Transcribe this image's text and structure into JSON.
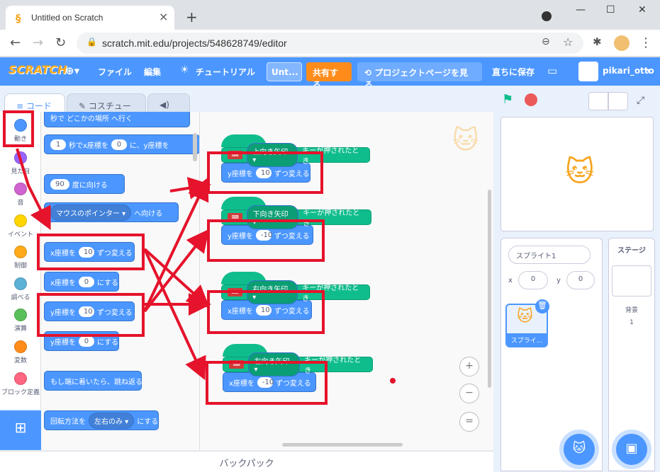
{
  "browser": {
    "tab_title": "Untitled on Scratch",
    "url": "scratch.mit.edu/projects/548628749/editor",
    "new_tab": "+",
    "win_minimize": "—",
    "win_maximize": "☐",
    "win_close": "✕"
  },
  "menubar": {
    "logo": "SCRATCH",
    "file": "ファイル",
    "edit": "編集",
    "tutorial": "チュートリアル",
    "project_title": "Unt...",
    "share": "共有する",
    "project_page": "プロジェクトページを見る",
    "save_now": "直ちに保存",
    "username": "pikari_otto"
  },
  "tabs": {
    "code": "コード",
    "costume": "コスチューム",
    "sound": "音"
  },
  "categories": [
    {
      "label": "動き",
      "color": "#4c97ff"
    },
    {
      "label": "見た目",
      "color": "#9966ff"
    },
    {
      "label": "音",
      "color": "#cf63cf"
    },
    {
      "label": "イベント",
      "color": "#ffd500"
    },
    {
      "label": "制御",
      "color": "#ffab19"
    },
    {
      "label": "調べる",
      "color": "#5cb1d6"
    },
    {
      "label": "演算",
      "color": "#59c059"
    },
    {
      "label": "変数",
      "color": "#ff8c1a"
    },
    {
      "label": "ブロック定義",
      "color": "#ff6680"
    }
  ],
  "palette": {
    "goto_top": "秒で どこかの場所 へ行く",
    "glide_secs": "1",
    "glide_text1": "秒でx座標を",
    "glide_x": "0",
    "glide_text2": "に、y座標を",
    "point_dir": "90",
    "point_text": "度に向ける",
    "towards_dd": "マウスのポインター ▾",
    "towards_text": "へ向ける",
    "change_x_text": "x座標を",
    "change_x_val": "10",
    "change_suffix": "ずつ変える",
    "set_x_text": "x座標を",
    "set_x_val": "0",
    "set_suffix": "にする",
    "change_y_text": "y座標を",
    "change_y_val": "10",
    "set_y_text": "y座標を",
    "set_y_val": "0",
    "bounce": "もし端に着いたら、跳ね返る",
    "rotation_text": "回転方法を",
    "rotation_dd": "左右のみ ▾",
    "rotation_suffix": "にする"
  },
  "scripts": [
    {
      "key_label": "上向き矢印 ▾",
      "event_suffix": "キーが押されたとき",
      "axis": "y座標を",
      "value": "10",
      "suffix": "ずつ変える"
    },
    {
      "key_label": "下向き矢印 ▾",
      "event_suffix": "キーが押されたとき",
      "axis": "y座標を",
      "value": "-10",
      "suffix": "ずつ変える"
    },
    {
      "key_label": "右向き矢印 ▾",
      "event_suffix": "キーが押されたとき",
      "axis": "x座標を",
      "value": "10",
      "suffix": "ずつ変える"
    },
    {
      "key_label": "左向き矢印 ▾",
      "event_suffix": "キーが押されたとき",
      "axis": "x座標を",
      "value": "-10",
      "suffix": "ずつ変える"
    }
  ],
  "backpack": "バックパック",
  "sprite_info": {
    "name": "スプライト1",
    "x_label": "x",
    "x_value": "0",
    "y_label": "y",
    "y_value": "0",
    "thumb_label": "スプライ..."
  },
  "stage_pane": {
    "title": "ステージ",
    "backdrops_label": "背景",
    "backdrops_count": "1"
  },
  "zoom": {
    "in": "+",
    "out": "−",
    "reset": "="
  },
  "colors": {
    "scratch_blue": "#4c97ff",
    "highlight_red": "#e5132b",
    "event_green": "#0fbd8c",
    "share_orange": "#ff8c1a"
  }
}
